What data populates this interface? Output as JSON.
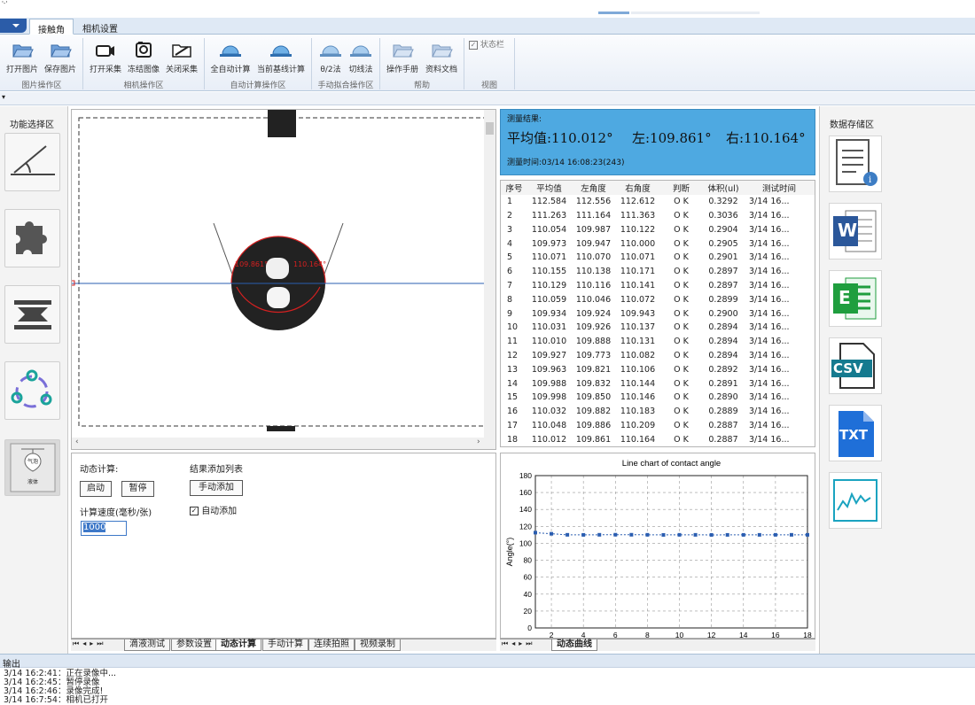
{
  "ribbon": {
    "tabs": [
      "接触角",
      "相机设置"
    ],
    "groups": [
      {
        "label": "图片操作区",
        "buttons": [
          "打开图片",
          "保存图片"
        ]
      },
      {
        "label": "相机操作区",
        "buttons": [
          "打开采集",
          "冻结图像",
          "关闭采集"
        ]
      },
      {
        "label": "自动计算操作区",
        "buttons": [
          "全自动计算",
          "当前基线计算"
        ]
      },
      {
        "label": "手动拟合操作区",
        "buttons": [
          "θ/2法",
          "切线法"
        ]
      },
      {
        "label": "帮助",
        "buttons": [
          "操作手册",
          "资料文档"
        ]
      },
      {
        "label": "视图",
        "checkbox": "状态栏",
        "checked": true
      }
    ]
  },
  "left_panel": {
    "title": "功能选择区",
    "items": [
      "contact-angle-icon",
      "puzzle-icon",
      "interface-tension-icon",
      "circle-dots-icon",
      "pendant-drop-icon"
    ],
    "pendant_labels": [
      "气泡",
      "液体"
    ]
  },
  "image_view": {
    "left_angle": "109.861°",
    "right_angle": "110.164°"
  },
  "dynamic": {
    "title": "动态计算:",
    "start": "启动",
    "pause": "暂停",
    "speed_label": "计算速度(毫秒/张)",
    "speed_value": "1000",
    "list_title": "结果添加列表",
    "manual_add": "手动添加",
    "auto_add": "自动添加",
    "auto_add_checked": true
  },
  "bottom_tabs": [
    "滴液测试",
    "参数设置",
    "动态计算",
    "手动计算",
    "连续拍照",
    "视频录制"
  ],
  "active_bottom_tab": "动态计算",
  "result": {
    "title": "测量结果:",
    "avg": "平均值:110.012°",
    "left": "左:109.861°",
    "right": "右:110.164°",
    "time": "测量时间:03/14 16:08:23(243)"
  },
  "table": {
    "headers": [
      "序号",
      "平均值",
      "左角度",
      "右角度",
      "判断",
      "体积(ul)",
      "测试时间"
    ],
    "rows": [
      [
        "1",
        "112.584",
        "112.556",
        "112.612",
        "O K",
        "0.3292",
        "3/14 16..."
      ],
      [
        "2",
        "111.263",
        "111.164",
        "111.363",
        "O K",
        "0.3036",
        "3/14 16..."
      ],
      [
        "3",
        "110.054",
        "109.987",
        "110.122",
        "O K",
        "0.2904",
        "3/14 16..."
      ],
      [
        "4",
        "109.973",
        "109.947",
        "110.000",
        "O K",
        "0.2905",
        "3/14 16..."
      ],
      [
        "5",
        "110.071",
        "110.070",
        "110.071",
        "O K",
        "0.2901",
        "3/14 16..."
      ],
      [
        "6",
        "110.155",
        "110.138",
        "110.171",
        "O K",
        "0.2897",
        "3/14 16..."
      ],
      [
        "7",
        "110.129",
        "110.116",
        "110.141",
        "O K",
        "0.2897",
        "3/14 16..."
      ],
      [
        "8",
        "110.059",
        "110.046",
        "110.072",
        "O K",
        "0.2899",
        "3/14 16..."
      ],
      [
        "9",
        "109.934",
        "109.924",
        "109.943",
        "O K",
        "0.2900",
        "3/14 16..."
      ],
      [
        "10",
        "110.031",
        "109.926",
        "110.137",
        "O K",
        "0.2894",
        "3/14 16..."
      ],
      [
        "11",
        "110.010",
        "109.888",
        "110.131",
        "O K",
        "0.2894",
        "3/14 16..."
      ],
      [
        "12",
        "109.927",
        "109.773",
        "110.082",
        "O K",
        "0.2894",
        "3/14 16..."
      ],
      [
        "13",
        "109.963",
        "109.821",
        "110.106",
        "O K",
        "0.2892",
        "3/14 16..."
      ],
      [
        "14",
        "109.988",
        "109.832",
        "110.144",
        "O K",
        "0.2891",
        "3/14 16..."
      ],
      [
        "15",
        "109.998",
        "109.850",
        "110.146",
        "O K",
        "0.2890",
        "3/14 16..."
      ],
      [
        "16",
        "110.032",
        "109.882",
        "110.183",
        "O K",
        "0.2889",
        "3/14 16..."
      ],
      [
        "17",
        "110.048",
        "109.886",
        "110.209",
        "O K",
        "0.2887",
        "3/14 16..."
      ],
      [
        "18",
        "110.012",
        "109.861",
        "110.164",
        "O K",
        "0.2887",
        "3/14 16..."
      ]
    ]
  },
  "chart_data": {
    "type": "line",
    "title": "Line chart of contact angle",
    "xlabel": "",
    "ylabel": "Angle(°)",
    "xlim": [
      1,
      18
    ],
    "ylim": [
      0,
      180
    ],
    "xticks": [
      2,
      4,
      6,
      8,
      10,
      12,
      14,
      16,
      18
    ],
    "yticks": [
      0,
      20,
      40,
      60,
      80,
      100,
      120,
      140,
      160,
      180
    ],
    "grid": true,
    "series": [
      {
        "x": [
          1,
          2,
          3,
          4,
          5,
          6,
          7,
          8,
          9,
          10,
          11,
          12,
          13,
          14,
          15,
          16,
          17,
          18
        ],
        "values": [
          112.584,
          111.263,
          110.054,
          109.973,
          110.071,
          110.155,
          110.129,
          110.059,
          109.934,
          110.031,
          110.01,
          109.927,
          109.963,
          109.988,
          109.998,
          110.032,
          110.048,
          110.012
        ],
        "color": "#2a5db0"
      }
    ]
  },
  "chart_tab": "动态曲线",
  "right_panel": {
    "title": "数据存储区",
    "items": [
      "report-icon",
      "word-icon",
      "excel-icon",
      "csv-icon",
      "txt-icon",
      "chart-export-icon"
    ],
    "labels": {
      "word": "W",
      "excel": "E",
      "csv": "CSV",
      "txt": "TXT"
    }
  },
  "output": {
    "title": "输出",
    "lines": [
      "3/14 16:2:41：正在录像中...",
      "3/14 16:2:45：暂停录像",
      "3/14 16:2:46：录像完成!",
      "3/14 16:7:54：相机已打开"
    ]
  },
  "colors": {
    "accent": "#2b5ca8",
    "result_bg": "#4ea9e1",
    "word": "#2b579a",
    "excel": "#1f9e3e",
    "csv": "#157a8f",
    "txt": "#1f6fd8"
  }
}
